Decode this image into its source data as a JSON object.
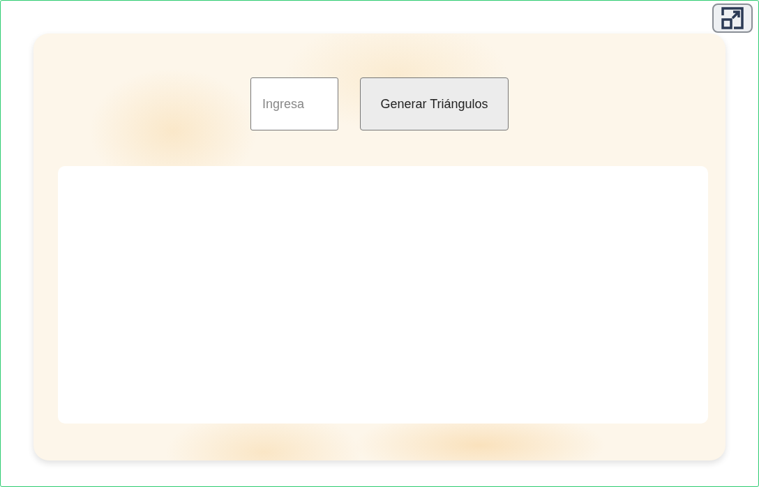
{
  "input": {
    "placeholder": "Ingresa"
  },
  "generate_button": {
    "label": "Generar Triángulos"
  }
}
